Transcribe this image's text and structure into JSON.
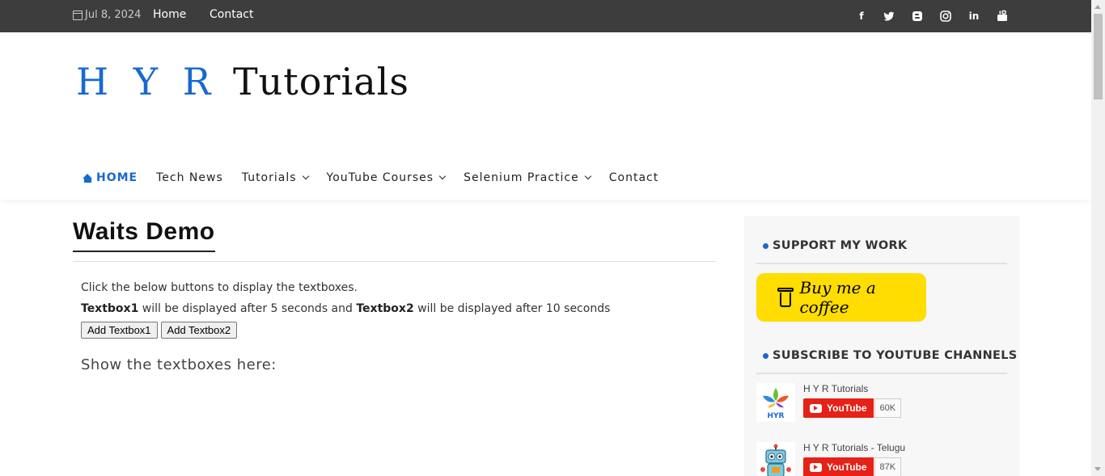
{
  "topbar": {
    "date": "Jul 8, 2024",
    "links": [
      "Home",
      "Contact"
    ],
    "social_icons": [
      "facebook-icon",
      "twitter-icon",
      "blogger-icon",
      "instagram-icon",
      "linkedin-icon",
      "youtube-icon"
    ]
  },
  "logo": {
    "part1": "H Y R",
    "part2": "Tutorials",
    "accent_color": "#1769d1"
  },
  "nav": {
    "home": "HOME",
    "tech_news": "Tech News",
    "tutorials": "Tutorials",
    "youtube_courses": "YouTube Courses",
    "selenium_practice": "Selenium Practice",
    "contact": "Contact"
  },
  "main": {
    "title": "Waits Demo",
    "line1": "Click the below buttons to display the textboxes.",
    "textbox1_label": "Textbox1",
    "line2_mid": " will be displayed after 5 seconds and ",
    "textbox2_label": "Textbox2",
    "line2_end": " will be displayed after 10 seconds",
    "button1": "Add Textbox1",
    "button2": "Add Textbox2",
    "show_label": "Show the textboxes here:"
  },
  "sidebar": {
    "support_title": "SUPPORT MY WORK",
    "coffee_label": "Buy me a coffee",
    "subscribe_title": "SUBSCRIBE TO YOUTUBE CHANNELS",
    "channels": [
      {
        "name": "H Y R Tutorials",
        "button": "YouTube",
        "count": "60K"
      },
      {
        "name": "H Y R Tutorials - Telugu",
        "button": "YouTube",
        "count": "87K"
      }
    ],
    "avatar1_text": "HYR"
  }
}
